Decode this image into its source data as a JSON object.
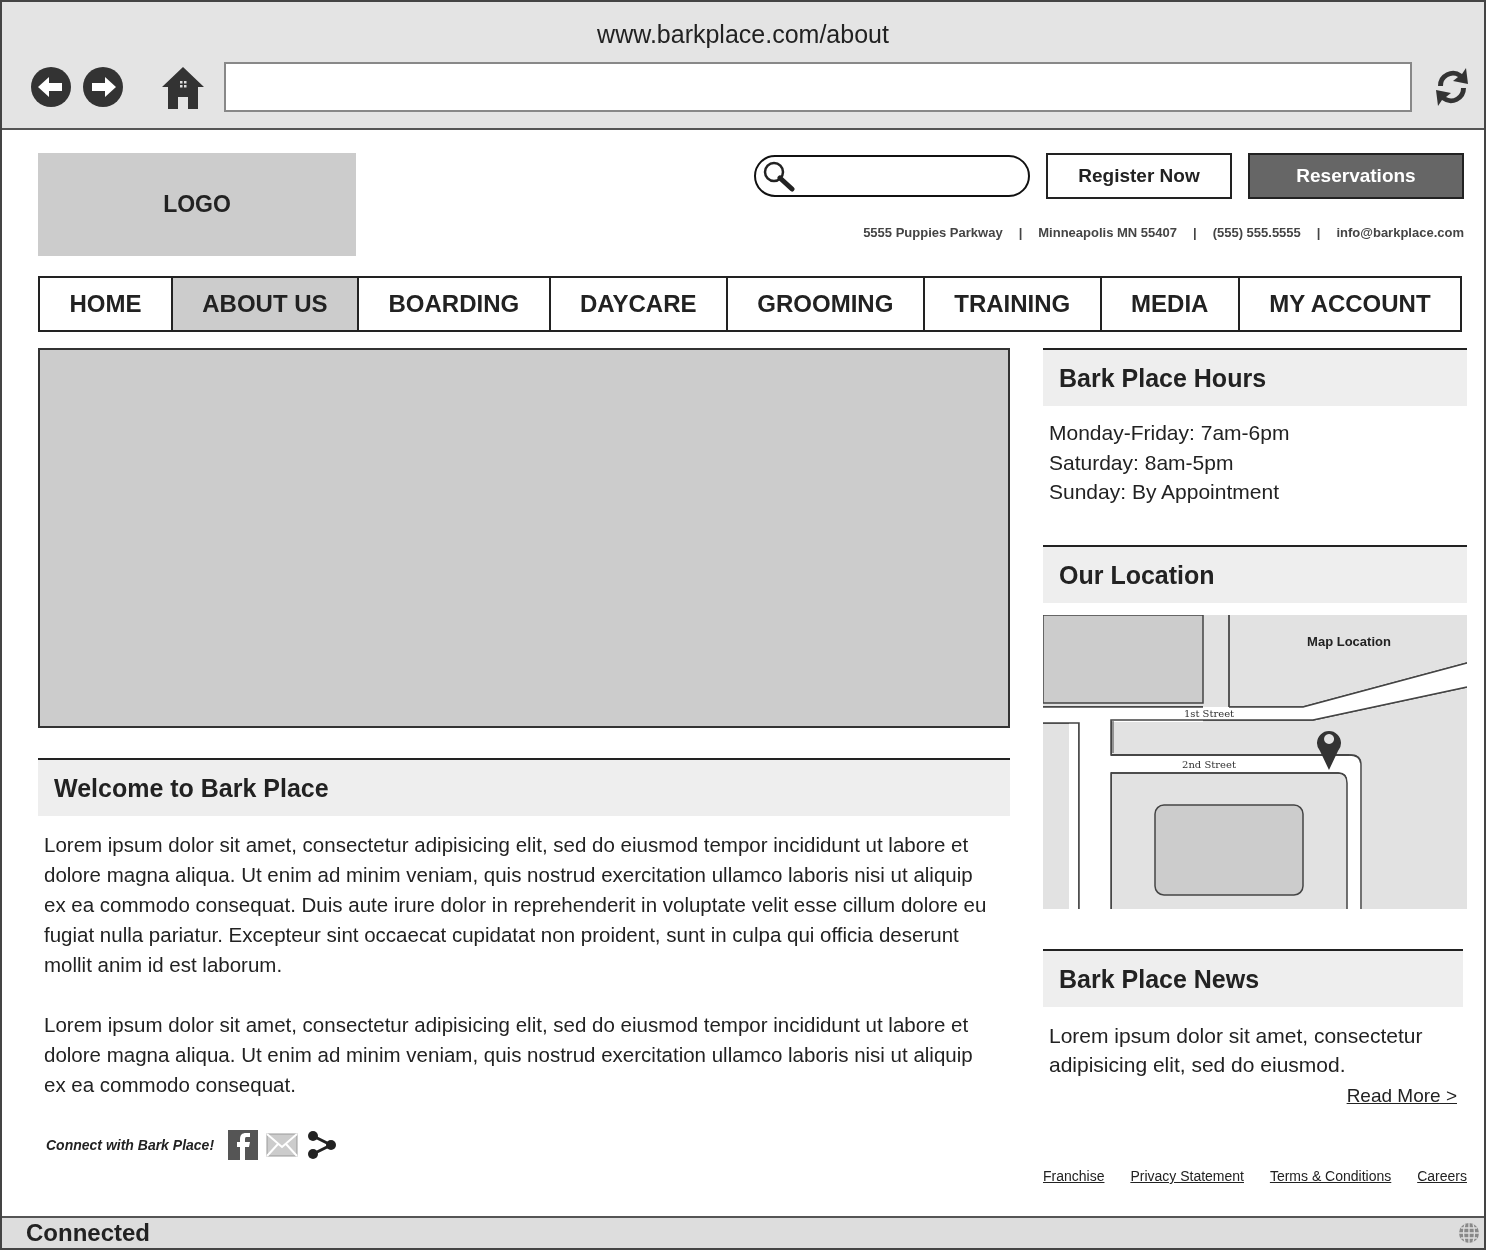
{
  "browser": {
    "url": "www.barkplace.com/about"
  },
  "header": {
    "logo": "LOGO",
    "buttons": [
      {
        "label": "Register Now",
        "kind": "outline"
      },
      {
        "label": "Reservations",
        "kind": "filled"
      }
    ],
    "contact": [
      "5555 Puppies Parkway",
      "Minneapolis MN 55407",
      "(555) 555.5555",
      "info@barkplace.com"
    ],
    "separator": "|"
  },
  "nav": [
    {
      "label": "HOME",
      "selected": false
    },
    {
      "label": "ABOUT US",
      "selected": true
    },
    {
      "label": "BOARDING",
      "selected": false
    },
    {
      "label": "DAYCARE",
      "selected": false
    },
    {
      "label": "GROOMING",
      "selected": false
    },
    {
      "label": "TRAINING",
      "selected": false
    },
    {
      "label": "MEDIA",
      "selected": false
    },
    {
      "label": "MY ACCOUNT",
      "selected": false
    }
  ],
  "welcome": {
    "title": "Welcome to Bark Place",
    "paragraphs": [
      "Lorem ipsum dolor sit amet, consectetur adipisicing elit, sed do eiusmod tempor incididunt ut labore et dolore magna aliqua. Ut enim ad minim veniam, quis nostrud exercitation ullamco laboris nisi ut aliquip ex ea commodo consequat. Duis aute irure dolor in reprehenderit in voluptate velit esse cillum dolore eu fugiat nulla pariatur. Excepteur sint occaecat cupidatat non proident, sunt in culpa qui officia deserunt mollit anim id est laborum.",
      "Lorem ipsum dolor sit amet, consectetur adipisicing elit, sed do eiusmod tempor incididunt ut labore et dolore magna aliqua. Ut enim ad minim veniam, quis nostrud exercitation ullamco laboris nisi ut aliquip ex ea commodo consequat."
    ]
  },
  "sidebar": {
    "hours": {
      "title": "Bark Place Hours",
      "lines": [
        "Monday-Friday: 7am-6pm",
        "Saturday: 8am-5pm",
        "Sunday: By Appointment"
      ]
    },
    "location": {
      "title": "Our Location",
      "map": {
        "label": "Map Location",
        "streets": [
          "1st Street",
          "2nd Street"
        ]
      }
    },
    "news": {
      "title": "Bark Place News",
      "text": "Lorem ipsum dolor sit amet, consectetur adipisicing elit, sed do eiusmod.",
      "link": "Read More >"
    }
  },
  "footer": {
    "connect": "Connect with Bark Place!",
    "links": [
      "Franchise",
      "Privacy Statement",
      "Terms & Conditions",
      "Careers"
    ]
  },
  "status_bar": {
    "text": "Connected"
  }
}
